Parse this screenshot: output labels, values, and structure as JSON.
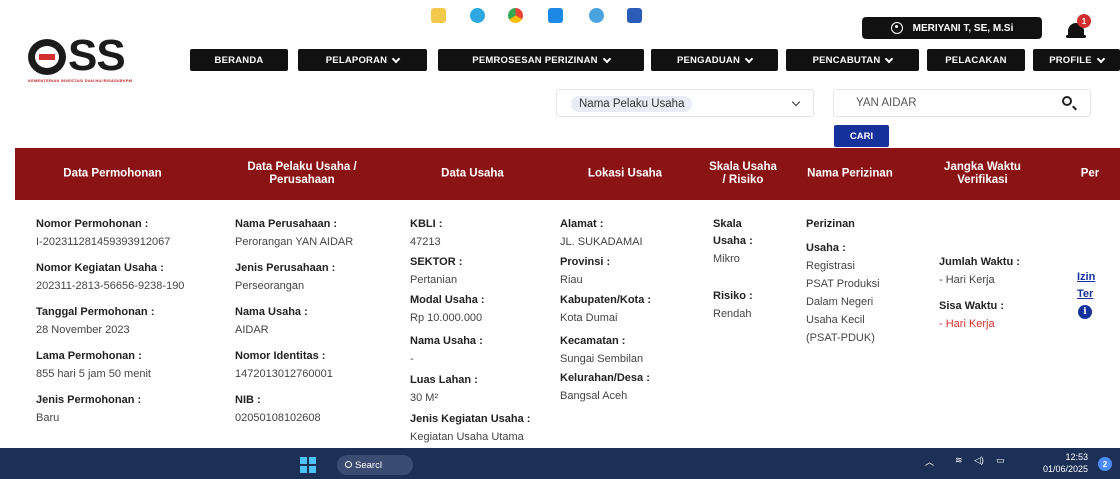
{
  "header": {
    "logo_text": "SS",
    "logo_subtitle": "KEMENTERIAN INVESTASI DAN HILIRISASI/BKPM",
    "user_name": "MERIYANI T, SE, M.Si",
    "notification_count": "1"
  },
  "nav": [
    {
      "label": "BERANDA"
    },
    {
      "label": "PELAPORAN"
    },
    {
      "label": "PEMROSESAN PERIZINAN"
    },
    {
      "label": "PENGADUAN"
    },
    {
      "label": "PENCABUTAN"
    },
    {
      "label": "PELACAKAN"
    },
    {
      "label": "PROFILE"
    }
  ],
  "search": {
    "filter_selected": "Nama Pelaku Usaha",
    "query": "YAN AIDAR",
    "button_label": "CARI"
  },
  "table": {
    "headers": [
      "Data Permohonan",
      "Data Pelaku Usaha / Perusahaan",
      "Data Usaha",
      "Lokasi Usaha",
      "Skala Usaha / Risiko",
      "Nama Perizinan",
      "Jangka Waktu Verifikasi",
      "Per"
    ],
    "row": {
      "permohonan": {
        "nomor_permohonan_label": "Nomor Permohonan :",
        "nomor_permohonan": "I-202311281459393912067",
        "nomor_kegiatan_label": "Nomor Kegiatan Usaha :",
        "nomor_kegiatan": "202311-2813-56656-9238-190",
        "tanggal_label": "Tanggal Permohonan :",
        "tanggal": "28 November 2023",
        "lama_label": "Lama Permohonan :",
        "lama": "855 hari 5 jam 50 menit",
        "jenis_label": "Jenis Permohonan :",
        "jenis": "Baru"
      },
      "pelaku": {
        "nama_perusahaan_label": "Nama Perusahaan :",
        "nama_perusahaan": "Perorangan YAN AIDAR",
        "jenis_perusahaan_label": "Jenis Perusahaan :",
        "jenis_perusahaan": "Perseorangan",
        "nama_usaha_label": "Nama Usaha :",
        "nama_usaha": "AIDAR",
        "nomor_identitas_label": "Nomor Identitas :",
        "nomor_identitas": "1472013012760001",
        "nib_label": "NIB :",
        "nib": "02050108102608"
      },
      "usaha": {
        "kbli_label": "KBLI :",
        "kbli": "47213",
        "sektor_label": "SEKTOR :",
        "sektor": "Pertanian",
        "modal_label": "Modal Usaha :",
        "modal": "Rp 10.000.000",
        "nama_usaha_label": "Nama Usaha :",
        "nama_usaha": "-",
        "luas_label": "Luas Lahan :",
        "luas": "30 M²",
        "jenis_kegiatan_label": "Jenis Kegiatan Usaha :",
        "jenis_kegiatan": "Kegiatan Usaha Utama"
      },
      "lokasi": {
        "alamat_label": "Alamat :",
        "alamat": "JL. SUKADAMAI",
        "provinsi_label": "Provinsi :",
        "provinsi": "Riau",
        "kabupaten_label": "Kabupaten/Kota :",
        "kabupaten": "Kota Dumai",
        "kecamatan_label": "Kecamatan :",
        "kecamatan": "Sungai Sembilan",
        "kelurahan_label": "Kelurahan/Desa :",
        "kelurahan": "Bangsal Aceh"
      },
      "skala": {
        "skala_label_1": "Skala",
        "skala_label_2": "Usaha :",
        "skala": "Mikro",
        "risiko_label": "Risiko :",
        "risiko": "Rendah"
      },
      "perizinan": {
        "label": "Perizinan",
        "usaha_label": "Usaha :",
        "lines": [
          "Registrasi",
          "PSAT Produksi",
          "Dalam Negeri",
          "Usaha Kecil",
          "(PSAT-PDUK)"
        ]
      },
      "verifikasi": {
        "jumlah_label": "Jumlah Waktu :",
        "jumlah": "- Hari Kerja",
        "sisa_label": "Sisa Waktu :",
        "sisa": "- Hari Kerja"
      },
      "per": {
        "link_1": "Izin",
        "link_2": "Ter",
        "info_glyph": "i"
      }
    }
  },
  "taskbar": {
    "search_label": "Searcl",
    "time": "12:53",
    "date": "01/06/2025",
    "notification_count": "2"
  },
  "colors": {
    "header_red": "#8a1414",
    "primary_blue": "#16329a",
    "alert_red": "#d32f2f",
    "taskbar": "#1c2f55"
  }
}
